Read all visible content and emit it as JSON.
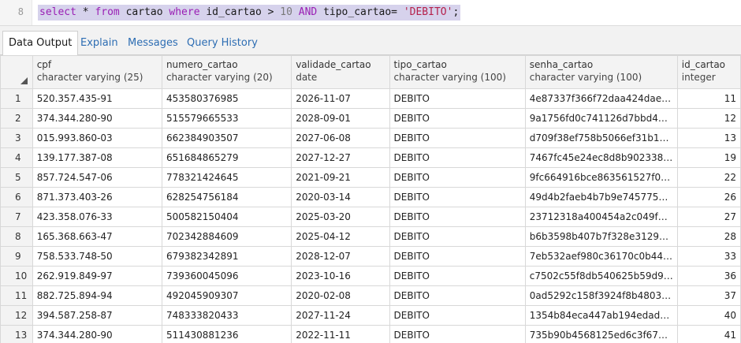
{
  "editor": {
    "line_number": "8",
    "query": {
      "select": "select",
      "star_from": " * ",
      "from": "from",
      "table": " cartao ",
      "where": "where",
      "cond1": " id_cartao > ",
      "ten": "10",
      "and_pad": " ",
      "and": "AND",
      "cond2": " tipo_cartao= ",
      "str": "'DEBITO'",
      "semicolon": ";"
    }
  },
  "tabs": [
    "Data Output",
    "Explain",
    "Messages",
    "Query History"
  ],
  "columns": [
    {
      "name": "cpf",
      "type": "character varying (25)"
    },
    {
      "name": "numero_cartao",
      "type": "character varying (20)"
    },
    {
      "name": "validade_cartao",
      "type": "date"
    },
    {
      "name": "tipo_cartao",
      "type": "character varying (100)"
    },
    {
      "name": "senha_cartao",
      "type": "character varying (100)"
    },
    {
      "name": "id_cartao",
      "type": "integer"
    }
  ],
  "rows": [
    [
      "1",
      "520.357.435-91",
      "453580376985",
      "2026-11-07",
      "DEBITO",
      "4e87337f366f72daa424dae…",
      "11"
    ],
    [
      "2",
      "374.344.280-90",
      "515579665533",
      "2028-09-01",
      "DEBITO",
      "9a1756fd0c741126d7bbd4…",
      "12"
    ],
    [
      "3",
      "015.993.860-03",
      "662384903507",
      "2027-06-08",
      "DEBITO",
      "d709f38ef758b5066ef31b1…",
      "13"
    ],
    [
      "4",
      "139.177.387-08",
      "651684865279",
      "2027-12-27",
      "DEBITO",
      "7467fc45e24ec8d8b902338…",
      "19"
    ],
    [
      "5",
      "857.724.547-06",
      "778321424645",
      "2021-09-21",
      "DEBITO",
      "9fc664916bce863561527f0…",
      "22"
    ],
    [
      "6",
      "871.373.403-26",
      "628254756184",
      "2020-03-14",
      "DEBITO",
      "49d4b2faeb4b7b9e745775…",
      "26"
    ],
    [
      "7",
      "423.358.076-33",
      "500582150404",
      "2025-03-20",
      "DEBITO",
      "23712318a400454a2c049f…",
      "27"
    ],
    [
      "8",
      "165.368.663-47",
      "702342884609",
      "2025-04-12",
      "DEBITO",
      "b6b3598b407b7f328e3129…",
      "28"
    ],
    [
      "9",
      "758.533.748-50",
      "679382342891",
      "2028-12-07",
      "DEBITO",
      "7eb532aef980c36170c0b44…",
      "33"
    ],
    [
      "10",
      "262.919.849-97",
      "739360045096",
      "2023-10-16",
      "DEBITO",
      "c7502c55f8db540625b59d9…",
      "36"
    ],
    [
      "11",
      "882.725.894-94",
      "492045909307",
      "2020-02-08",
      "DEBITO",
      "0ad5292c158f3924f8b4803…",
      "37"
    ],
    [
      "12",
      "394.587.258-87",
      "748333820433",
      "2027-11-24",
      "DEBITO",
      "1354b84eca447ab194edad…",
      "40"
    ],
    [
      "13",
      "374.344.280-90",
      "511430881236",
      "2022-11-11",
      "DEBITO",
      "735b90b4568125ed6c3f67…",
      "41"
    ]
  ]
}
